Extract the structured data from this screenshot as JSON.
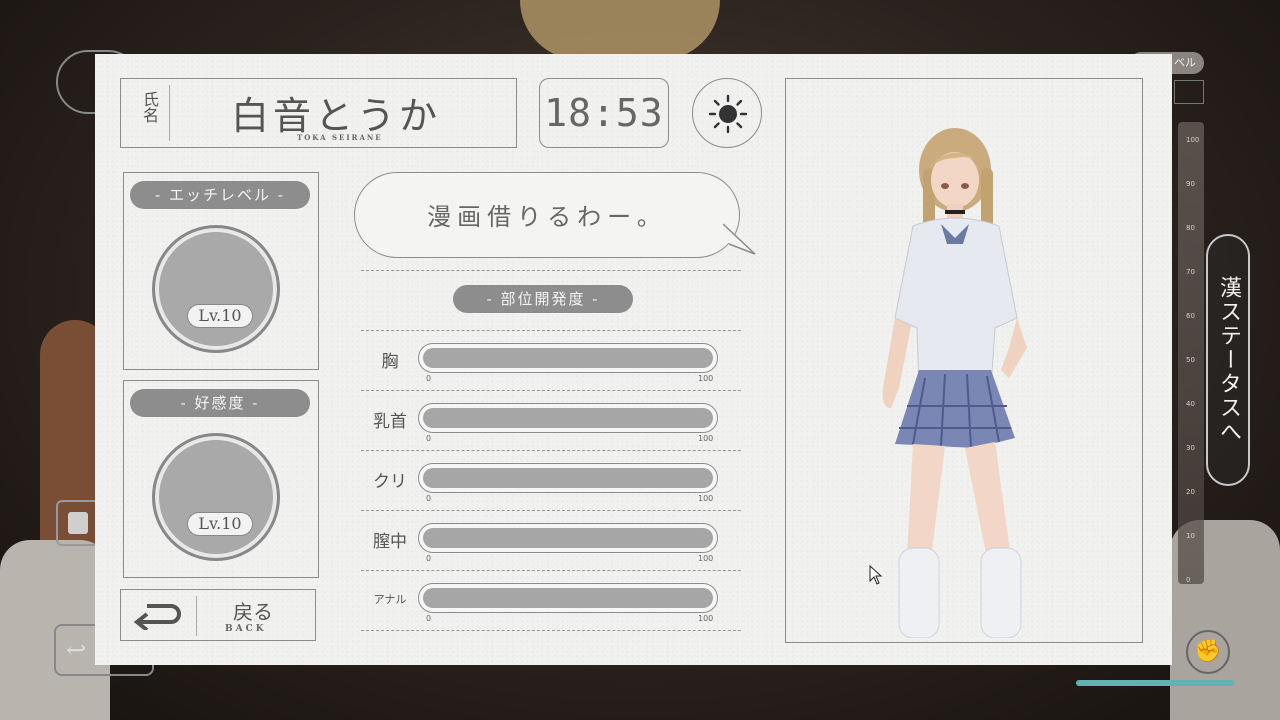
{
  "profile": {
    "name_label": "氏名",
    "name": "白音とうか",
    "name_roman": "TOKA SEIRANE",
    "time": "18:53",
    "time_icon": "sun-icon"
  },
  "ecchi_level": {
    "title": "- エッチレベル -",
    "level": "Lv.10"
  },
  "affection": {
    "title": "- 好感度 -",
    "level": "Lv.10"
  },
  "speech": {
    "text": "漫画借りるわー。"
  },
  "development": {
    "title": "- 部位開発度 -",
    "min_label": "0",
    "max_label": "100",
    "parts": [
      {
        "label": "胸",
        "value": 0
      },
      {
        "label": "乳首",
        "value": 0
      },
      {
        "label": "クリ",
        "value": 0
      },
      {
        "label": "膣中",
        "value": 0
      },
      {
        "label": "アナル",
        "value": 0
      }
    ]
  },
  "back_button": {
    "label_jp": "戻る",
    "label_en": "BACK"
  },
  "status_button": {
    "label": "漢ステータスへ"
  },
  "hud": {
    "top_right_label": "ベル",
    "gauge_ticks": [
      "100",
      "90",
      "80",
      "70",
      "60",
      "50",
      "40",
      "30",
      "20",
      "10",
      "0"
    ],
    "accent_color": "#5fb3b2"
  }
}
